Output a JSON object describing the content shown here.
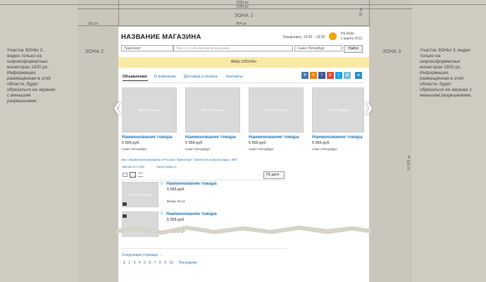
{
  "measure": {
    "w1920": "1920 px",
    "w1260": "1260 px",
    "zone1": "ЗОНА 1",
    "left_offset": "183 px",
    "content_width": "954 px",
    "top_height": "32 px",
    "page_height": "10 125 px"
  },
  "zones": {
    "zone2_label": "ЗОНА 2",
    "zone3_label": "ЗОНА 3",
    "zone2_note": "Участок ЗОНЫ 2, виден только на широкоформатных мониторах 1920 px. Информация, размещённая в этой области, будет обрезаться на экранах с меньшим разрешением.",
    "zone3_note": "Участок ЗОНЫ 3, виден только на широкоформатных мониторах 1920 px. Информация, размещённая в этой области, будет обрезаться на экранах с меньшим разрешением."
  },
  "header": {
    "store_name": "НАЗВАНИЕ МАГАЗИНА",
    "hours": "Ежедневно, 10:00 – 19:00",
    "avito_line1": "На Avito",
    "avito_line2": "с марта 2012"
  },
  "search": {
    "category": "Транспорт",
    "placeholder": "Поиск по объявлениям магазина",
    "city": "Санкт-Петербург",
    "button": "Найти"
  },
  "slogan": "ВАШ СЛОГАН",
  "tabs": [
    "Объявления",
    "О компании",
    "Доставка и оплата",
    "Контакты"
  ],
  "social": [
    {
      "letter": "В",
      "color": "#4a76a8"
    },
    {
      "letter": "О",
      "color": "#ee8208"
    },
    {
      "letter": "f",
      "color": "#3b5998"
    },
    {
      "letter": "G",
      "color": "#dd4b39"
    },
    {
      "letter": "t",
      "color": "#1da1f2"
    },
    {
      "letter": "@",
      "color": "#7ab8de"
    },
    {
      "letter": "✉",
      "color": "#2d8ec4"
    }
  ],
  "carousel": [
    {
      "img": "ФОТО ТОВАРА",
      "name": "Наименование товара",
      "price": "5 555 руб.",
      "city": "Санкт-Петербург"
    },
    {
      "img": "ФОТО ТОВАРА",
      "name": "Наименование товара",
      "price": "5 555 руб.",
      "city": "Санкт-Петербург"
    },
    {
      "img": "ФОТО ТОВАРА",
      "name": "Наименование товара",
      "price": "5 555 руб.",
      "city": "Санкт-Петербург"
    },
    {
      "img": "ФОТО ТОВАРА",
      "name": "Наименование товара",
      "price": "5 555 руб.",
      "city": "Санкт-Петербург"
    }
  ],
  "breadcrumb": "Все объявления магазина в России / Транспорт / Запчасти и аксессуары / 250",
  "filters": {
    "parts": "Запчасти 1 236",
    "accessories": "Аксессуары 2"
  },
  "sort": "По дате",
  "listing": [
    {
      "img": "ФОТО ТОВАРА",
      "name": "Наименование товара",
      "price": "5 555 руб.",
      "date": "Вчера 15:14"
    },
    {
      "img": "",
      "name": "Наименование товара",
      "price": "5 555 руб.",
      "date": "Вчера 17:17"
    }
  ],
  "next_page": "Следующая страница →",
  "pages": [
    "1",
    "2",
    "3",
    "4",
    "5",
    "6",
    "7",
    "8",
    "9",
    "10"
  ],
  "last_page": "Последняя"
}
